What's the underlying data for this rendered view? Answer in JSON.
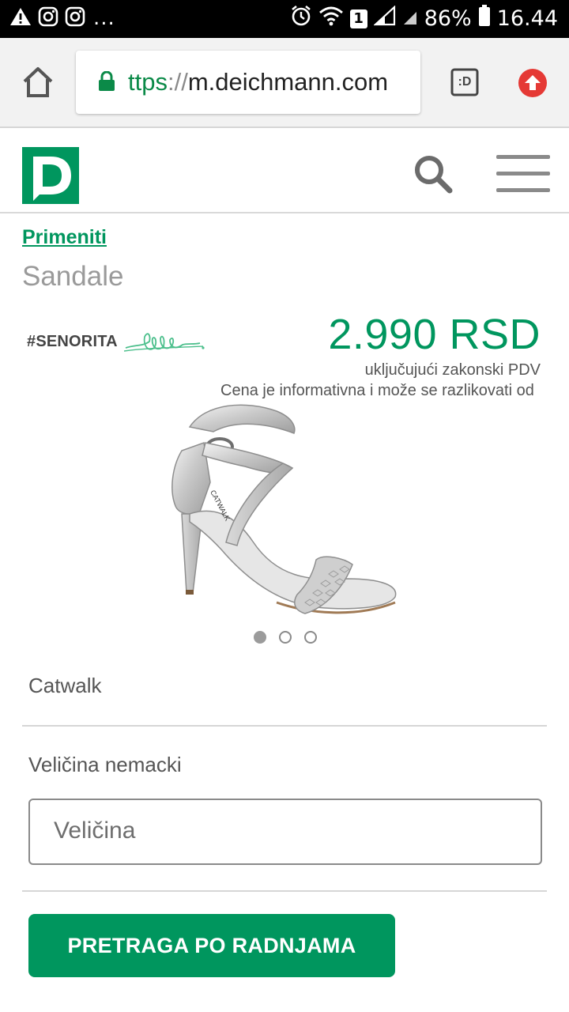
{
  "status_bar": {
    "battery": "86%",
    "time": "16.44",
    "sim_badge": "1",
    "overflow": "..."
  },
  "browser": {
    "url_scheme_visible": "ttps",
    "url_separator": "://",
    "url_host": "m.deichmann.com",
    "tab_switcher_label": ":D"
  },
  "site": {
    "logo_letter": "D",
    "accent_color": "#00965e"
  },
  "product": {
    "apply_link": "Primeniti",
    "category": "Sandale",
    "collection_tag": "#SENORITA",
    "price": "2.990 RSD",
    "vat_note": "uključujući zakonski PDV",
    "disclaimer": "Cena je informativna i može se razlikovati od",
    "brand": "Catwalk",
    "shoe_print": "CATWALK",
    "carousel": {
      "total": 3,
      "active": 1
    }
  },
  "size": {
    "label": "Veličina nemacki",
    "placeholder": "Veličina"
  },
  "cta": {
    "label": "PRETRAGA PO RADNJAMA"
  }
}
